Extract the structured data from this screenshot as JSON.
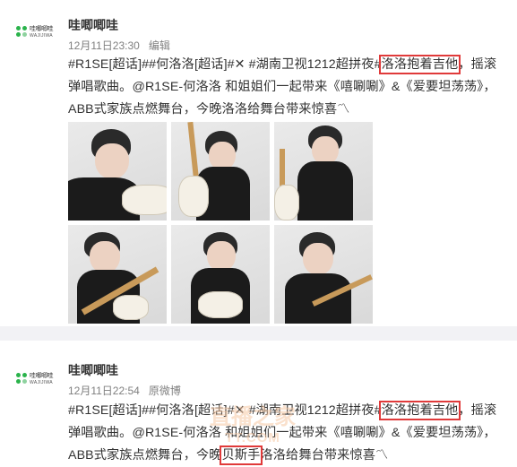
{
  "posts": [
    {
      "user": {
        "name": "哇唧唧哇",
        "logo_cn": "哇唧唧哇",
        "logo_en": "WAJIJIWA"
      },
      "time": "12月11日23:30",
      "source": "编辑",
      "text": {
        "l1_a": "#R1SE[超话]##何洛洛[超话]#✕ #湖南卫视1212超拼夜#",
        "l1_hl": "洛洛抱着吉他",
        "l1_b": "，摇滚",
        "l2": "弹唱歌曲。@R1SE-何洛洛 和姐姐们一起带来《嘻唰唰》&《爱要坦荡荡》，",
        "l3": "ABB式家族点燃舞台，今晚洛洛给舞台带来惊喜〽"
      },
      "images": [
        "photo-1",
        "photo-2",
        "photo-3",
        "photo-4",
        "photo-5",
        "photo-6"
      ]
    },
    {
      "user": {
        "name": "哇唧唧哇",
        "logo_cn": "哇唧唧哇",
        "logo_en": "WAJIJIWA"
      },
      "time": "12月11日22:54",
      "source": "原微博",
      "text": {
        "l1_a": "#R1SE[超话]##何洛洛[超话]#✕ #湖南卫视1212超拼夜#",
        "l1_hl": "洛洛抱着吉他",
        "l1_b": "，摇滚",
        "l2": "弹唱歌曲。@R1SE-何洛洛 和姐姐们一起带来《嘻唰唰》&《爱要坦荡荡》，",
        "l3_a": "ABB式家族点燃舞台，今晚",
        "l3_hl": "贝斯手",
        "l3_b": "洛洛给舞台带来惊喜〽"
      }
    }
  ],
  "watermark": {
    "line1": "直播之家",
    "line2": "TT.COM"
  },
  "colors": {
    "highlight_border": "#e03a3a",
    "logo_green": "#2ab34b",
    "separator": "#f2f2f5"
  }
}
